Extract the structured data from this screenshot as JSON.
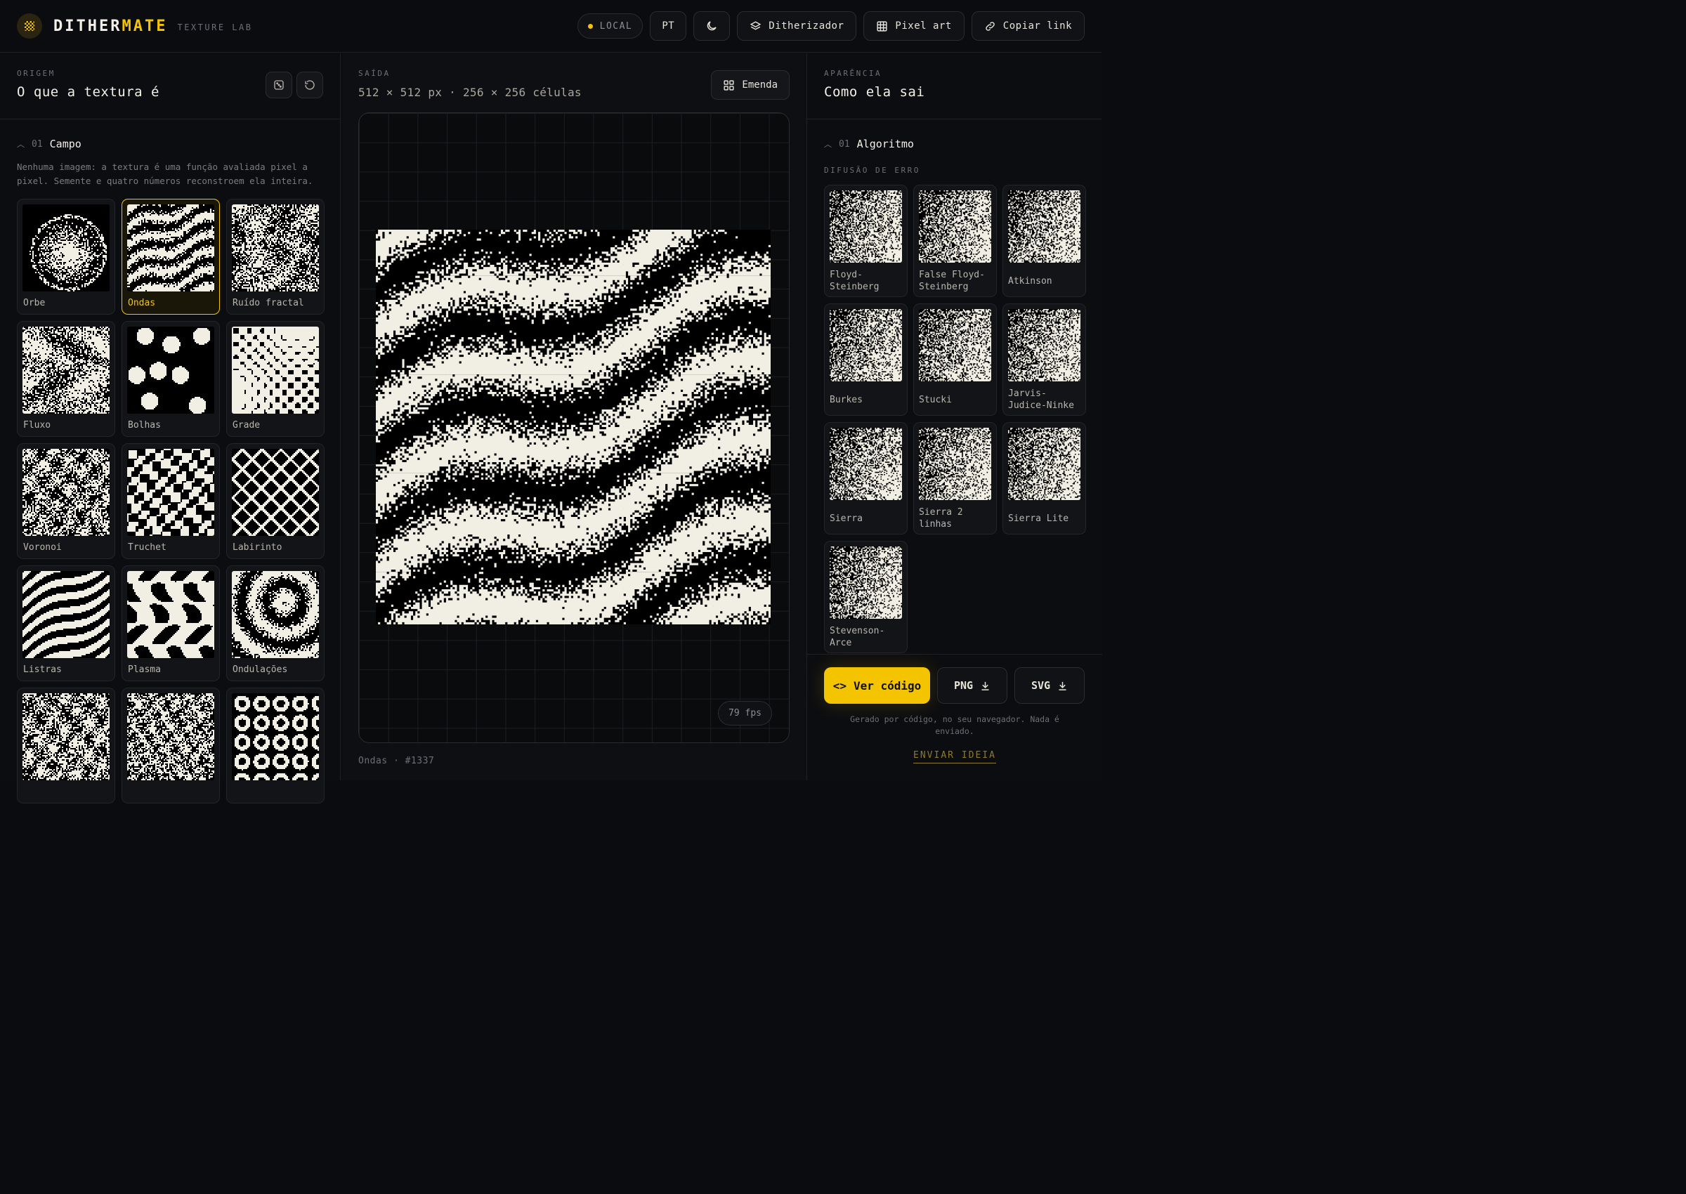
{
  "header": {
    "brand_a": "DITHER",
    "brand_b": "MATE",
    "brand_sub": "TEXTURE LAB",
    "status": "LOCAL",
    "lang": "PT",
    "ditherizer": "Ditherizador",
    "pixelart": "Pixel art",
    "copy_link": "Copiar link",
    "accent": "#f5c400"
  },
  "left": {
    "eyebrow": "ORIGEM",
    "title": "O que a textura é",
    "section_num": "01",
    "section_label": "Campo",
    "description": "Nenhuma imagem: a textura é uma função avaliada pixel a pixel. Semente e quatro números reconstroem ela inteira.",
    "fields": [
      {
        "label": "Orbe",
        "icon": "orb"
      },
      {
        "label": "Ondas",
        "icon": "waves",
        "selected": true
      },
      {
        "label": "Ruído fractal",
        "icon": "fractal-noise"
      },
      {
        "label": "Fluxo",
        "icon": "flow"
      },
      {
        "label": "Bolhas",
        "icon": "bubbles"
      },
      {
        "label": "Grade",
        "icon": "grid"
      },
      {
        "label": "Voronoi",
        "icon": "voronoi"
      },
      {
        "label": "Truchet",
        "icon": "truchet"
      },
      {
        "label": "Labirinto",
        "icon": "maze"
      },
      {
        "label": "Listras",
        "icon": "stripes"
      },
      {
        "label": "Plasma",
        "icon": "plasma"
      },
      {
        "label": "Ondulações",
        "icon": "ripples"
      },
      {
        "label": "",
        "icon": "noise-a"
      },
      {
        "label": "",
        "icon": "noise-b"
      },
      {
        "label": "",
        "icon": "rings"
      }
    ]
  },
  "middle": {
    "eyebrow": "SAÍDA",
    "dims": "512 × 512 px · 256 × 256 células",
    "emenda": "Emenda",
    "fps": "79 fps",
    "footer": "Ondas · #1337"
  },
  "right": {
    "eyebrow": "APARÊNCIA",
    "title": "Como ela sai",
    "section_num": "01",
    "section_label": "Algoritmo",
    "sub_eyebrow": "DIFUSÃO DE ERRO",
    "algorithms": [
      {
        "label": "Floyd-\nSteinberg"
      },
      {
        "label": "False Floyd-\nSteinberg"
      },
      {
        "label": "Atkinson"
      },
      {
        "label": "Burkes"
      },
      {
        "label": "Stucki"
      },
      {
        "label": "Jarvis-\nJudice-Ninke"
      },
      {
        "label": "Sierra"
      },
      {
        "label": "Sierra 2\nlinhas"
      },
      {
        "label": "Sierra Lite"
      },
      {
        "label": "Stevenson-\nArce"
      }
    ],
    "view_code": "Ver código",
    "png": "PNG",
    "svg": "SVG",
    "note": "Gerado por código, no seu navegador. Nada é enviado.",
    "idea": "ENVIAR IDEIA"
  }
}
